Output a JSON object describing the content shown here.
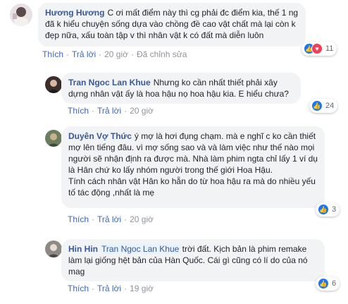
{
  "colors": {
    "link": "#385898",
    "action": "#4267b2",
    "bubble": "#f2f3f5",
    "like": "#1877f2",
    "love": "#f33e58"
  },
  "comments": [
    {
      "author": "Hương Hương",
      "text": "C ơi mất điểm này thì cg phải đc điểm kia, thế 1 ng đã k hiểu chuyện sống dựa vào chồng đề cao vật chất mà lại còn k đẹp nữa, xấu toàn tập v thì nhân vật k có đất mà diễn luôn",
      "like_label": "Thích",
      "reply_label": "Trả lời",
      "time": "20 giờ",
      "edited": "Đã chỉnh sửa",
      "reaction_icons": [
        "like-icon",
        "love-icon"
      ],
      "reaction_count": "11"
    },
    {
      "author": "Tran Ngoc Lan Khue",
      "text": "Nhưng ko cần nhất thiết phải xây dựng nhân vật ấy là hoa hậu nọ hoa hậu kia. E hiểu chưa?",
      "like_label": "Thích",
      "reply_label": "Trả lời",
      "time": "20 giờ",
      "reaction_icons": [
        "like-icon"
      ],
      "reaction_count": "24"
    },
    {
      "author": "Duyên Vợ Thức",
      "text": "ý mợ là hơi đụng chạm. mà e nghĩ c ko cần thiết mợ lên tiếng đâu. vì mợ sống sao và và làm việc như thế nào mọi người sẽ nhận định ra được mà. Nhà làm phim ngta chỉ lấy 1 ví dụ là Hân chứ ko lấy nhóm người trong thế giới Hoa Hậu.",
      "text2": "Tính cách nhân vật Hân ko hẵn do từ hoa hậu ra mà do nhiều yếu tố tác động ,nhất là mẹ",
      "like_label": "Thích",
      "reply_label": "Trả lời",
      "time": "20 giờ",
      "reaction_icons": [
        "like-icon"
      ],
      "reaction_count": "3"
    },
    {
      "author": "Hin Hin",
      "mention": "Tran Ngoc Lan Khue",
      "text": "trời đất. Kịch bản là phim remake làm lại giống hệt bản của Hàn Quốc. Cái gì cũng có lí do của nó mag",
      "like_label": "Thích",
      "reply_label": "Trả lời",
      "time": "19 giờ",
      "reaction_icons": [
        "like-icon"
      ],
      "reaction_count": "6"
    }
  ]
}
